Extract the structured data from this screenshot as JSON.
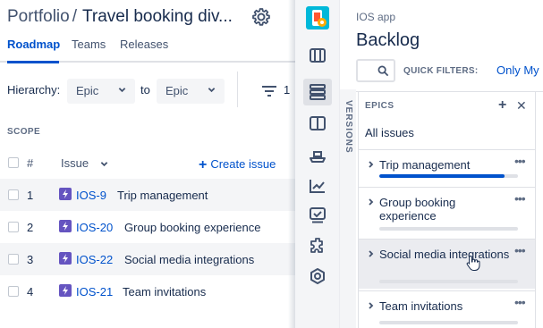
{
  "portfolio": {
    "breadcrumb": "Portfolio",
    "separator": "/",
    "plan_name": "Travel booking div...",
    "tabs": [
      {
        "label": "Roadmap",
        "active": true
      },
      {
        "label": "Teams",
        "active": false
      },
      {
        "label": "Releases",
        "active": false
      }
    ],
    "hierarchy": {
      "label": "Hierarchy:",
      "from_value": "Epic",
      "to_label": "to",
      "to_value": "Epic"
    },
    "filter_count": "1",
    "scope": {
      "section_label": "SCOPE",
      "col_number": "#",
      "col_issue": "Issue",
      "create_label": "Create issue",
      "rows": [
        {
          "num": "1",
          "key": "IOS-9",
          "summary": "Trip management"
        },
        {
          "num": "2",
          "key": "IOS-20",
          "summary": "Group booking experience"
        },
        {
          "num": "3",
          "key": "IOS-22",
          "summary": "Social media integrations"
        },
        {
          "num": "4",
          "key": "IOS-21",
          "summary": "Team invitations"
        }
      ]
    }
  },
  "board": {
    "project": "IOS app",
    "title": "Backlog",
    "quick_filters_label": "QUICK FILTERS:",
    "quick_filter_1": "Only My",
    "versions_label": "VERSIONS",
    "epics_panel": {
      "title": "EPICS",
      "add_symbol": "+",
      "close_symbol": "✕",
      "all_issues": "All issues",
      "more_symbol": "•••",
      "epics": [
        {
          "name": "Trip management",
          "progress": 0.9
        },
        {
          "name": "Group booking experience",
          "progress": 0.0
        },
        {
          "name": "Social media integrations",
          "progress": 0.0
        },
        {
          "name": "Team invitations",
          "progress": 0.0
        }
      ]
    }
  },
  "colors": {
    "accent": "#0052cc",
    "epic_icon": "#6554c0",
    "app_avatar": "#00b8d9",
    "row_shade": "#f4f5f7"
  },
  "icons": [
    "gear-icon",
    "chevron-down-icon",
    "filter-icon",
    "plus-icon",
    "epic-icon",
    "search-icon",
    "board-icon",
    "backlog-icon",
    "columns-icon",
    "releases-icon",
    "reports-icon",
    "issues-icon",
    "components-icon",
    "settings-icon",
    "more-icon",
    "close-icon",
    "hand-cursor-icon"
  ]
}
